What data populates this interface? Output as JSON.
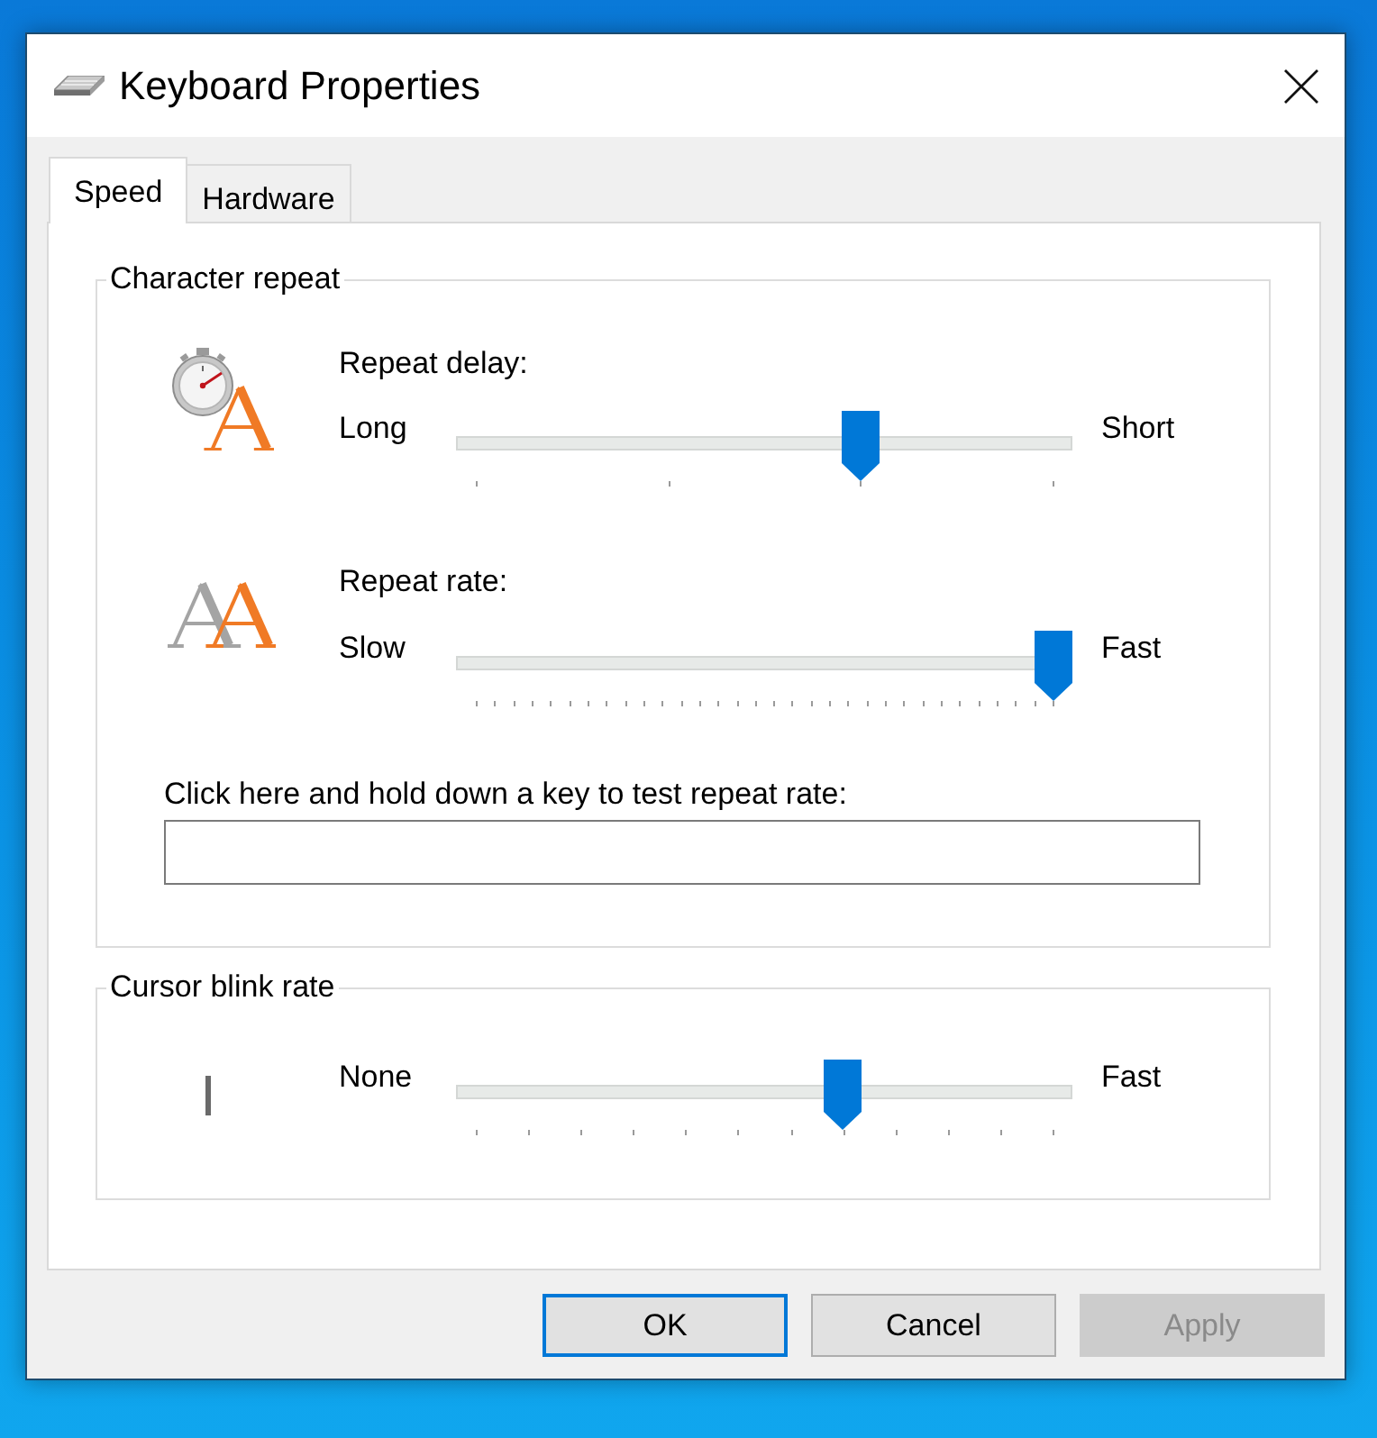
{
  "window": {
    "title": "Keyboard Properties"
  },
  "tabs": [
    {
      "label": "Speed",
      "selected": true
    },
    {
      "label": "Hardware",
      "selected": false
    }
  ],
  "character_repeat": {
    "title": "Character repeat",
    "repeat_delay": {
      "label": "Repeat delay:",
      "min_label": "Long",
      "max_label": "Short",
      "level": 0.667
    },
    "repeat_rate": {
      "label": "Repeat rate:",
      "min_label": "Slow",
      "max_label": "Fast",
      "level": 1
    },
    "test_field": {
      "label": "Click here and hold down a key to test repeat rate:"
    }
  },
  "cursor_blink_rate": {
    "title": "Cursor blink rate",
    "min_label": "None",
    "max_label": "Fast",
    "level": 0.636
  },
  "buttons": [
    {
      "label": "OK",
      "focused": true,
      "disabled": false
    },
    {
      "label": "Cancel",
      "focused": false,
      "disabled": false
    },
    {
      "label": "Apply",
      "focused": false,
      "disabled": true
    }
  ]
}
